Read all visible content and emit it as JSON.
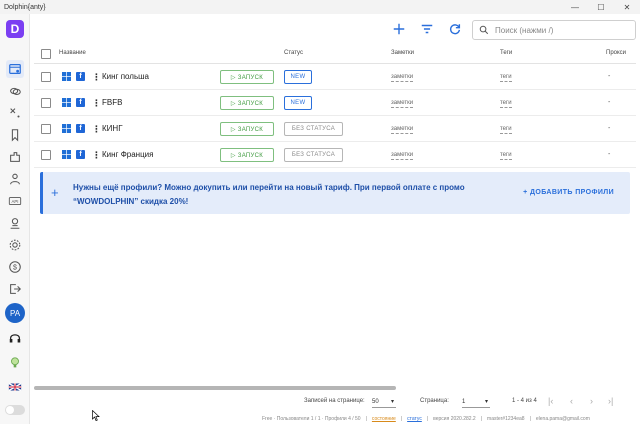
{
  "window": {
    "title": "Dolphin{anty}",
    "minimize": "—",
    "maximize": "☐",
    "close": "✕"
  },
  "logo": {
    "letter": "D",
    "color": "#7b3ff2"
  },
  "sidebar": {
    "icons": [
      "browser-profiles-icon",
      "cloud-sync-icon",
      "proxy-icon",
      "bookmarks-icon",
      "extensions-icon",
      "team-icon",
      "api-icon",
      "scenario-icon",
      "settings-icon",
      "billing-icon",
      "logout-icon",
      "support-icon",
      "tips-icon"
    ],
    "avatar": "PA",
    "language": "EN"
  },
  "toolbar": {
    "search_placeholder": "Поиск (нажми /)"
  },
  "table": {
    "headers": {
      "name": "Название",
      "status": "Статус",
      "notes": "Заметки",
      "tags": "Теги",
      "proxy": "Прокси"
    },
    "run_label": "▷ ЗАПУСК",
    "rows": [
      {
        "name": "Кинг польша",
        "status": "NEW",
        "notes": "заметки",
        "tags": "теги",
        "proxy": "-"
      },
      {
        "name": "FBFB",
        "status": "NEW",
        "notes": "заметки",
        "tags": "теги",
        "proxy": "-"
      },
      {
        "name": "КИНГ",
        "status": "БЕЗ СТАТУСА",
        "notes": "заметки",
        "tags": "теги",
        "proxy": "-"
      },
      {
        "name": "Кинг Франция",
        "status": "БЕЗ СТАТУСА",
        "notes": "заметки",
        "tags": "теги",
        "proxy": "-"
      }
    ]
  },
  "promo": {
    "plus": "+",
    "text": "Нужны ещё профили? Можно докупить или перейти на новый тариф. При первой оплате с промо “WOWDOLPHIN” скидка 20%!",
    "button": "+ ДОБАВИТЬ ПРОФИЛИ"
  },
  "pagination": {
    "per_page_label": "Записей на странице:",
    "per_page_value": "50",
    "page_label": "Страница:",
    "page_value": "1",
    "range": "1 - 4 из 4"
  },
  "footer": {
    "plan": "Free · Пользователи 1 / 1 · Профили 4 / 50",
    "link1": "состояние",
    "link2": "статус",
    "version": "версия 2020.282.2",
    "build": "master#1234ea8",
    "email": "elena.pama@gmail.com"
  },
  "colors": {
    "accent": "#2a6fdb",
    "run": "#3f9a3f",
    "promo_bg": "#e4ecfa",
    "avatar": "#1e64c8"
  }
}
